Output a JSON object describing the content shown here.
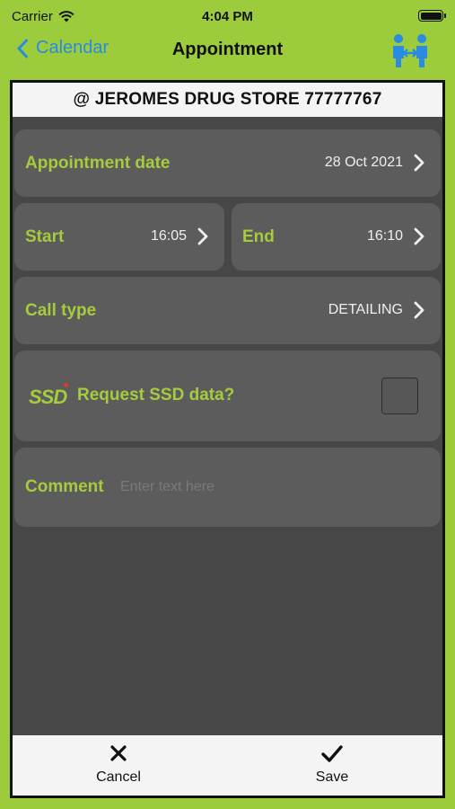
{
  "status_bar": {
    "carrier": "Carrier",
    "time": "4:04 PM"
  },
  "nav": {
    "back_label": "Calendar",
    "title": "Appointment",
    "action_icon": "meeting-people-icon"
  },
  "store_header": "@ JEROMES DRUG STORE 77777767",
  "appointment_date": {
    "label": "Appointment date",
    "value": "28 Oct 2021"
  },
  "start": {
    "label": "Start",
    "value": "16:05"
  },
  "end": {
    "label": "End",
    "value": "16:10"
  },
  "call_type": {
    "label": "Call type",
    "value": "DETAILING"
  },
  "ssd": {
    "logo_text": "SSD",
    "label": "Request SSD data?",
    "checked": false
  },
  "comment": {
    "label": "Comment",
    "placeholder": "Enter text here",
    "value": ""
  },
  "toolbar": {
    "cancel_label": "Cancel",
    "save_label": "Save"
  },
  "colors": {
    "accent_green": "#a4cc3c",
    "frame_green": "#9ccc3c",
    "link_blue": "#2a8be0",
    "card_bg": "#5c5c5c",
    "page_bg": "#474747"
  }
}
